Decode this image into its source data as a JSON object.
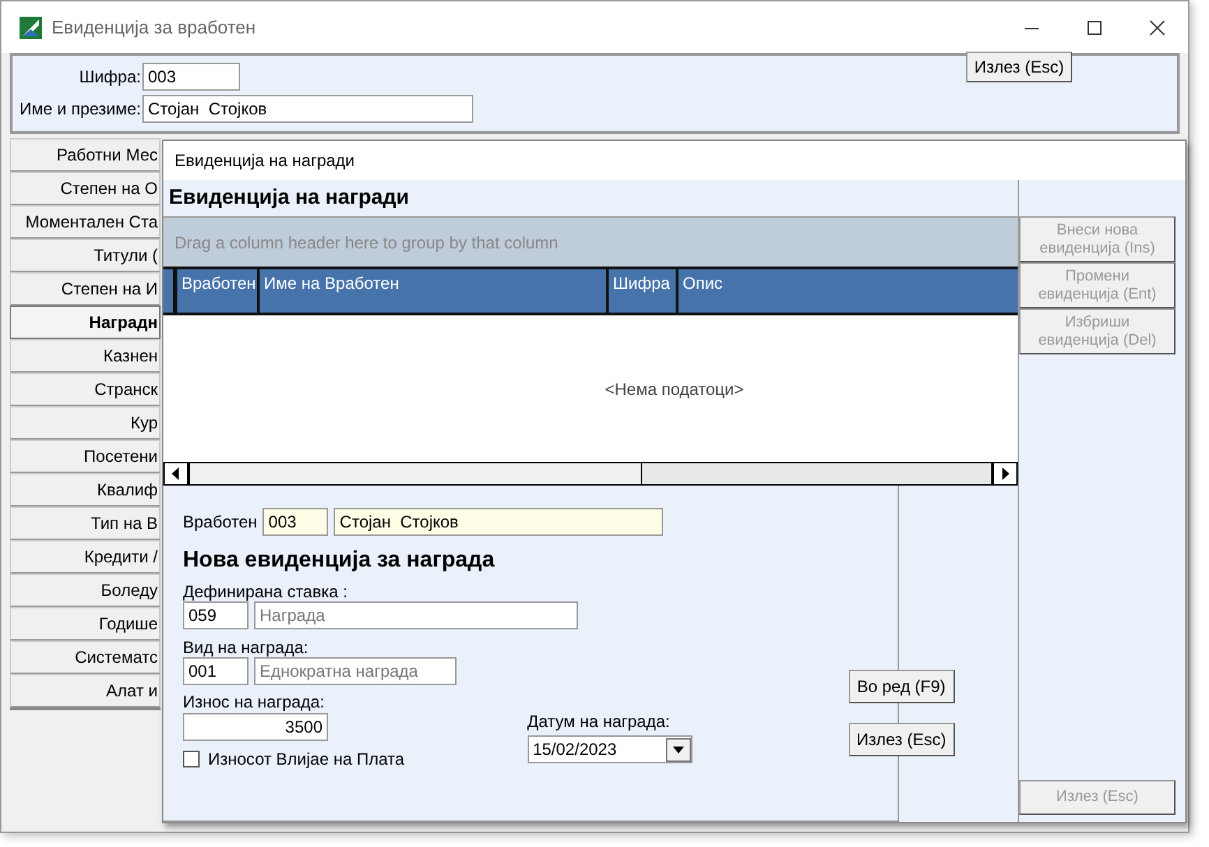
{
  "window": {
    "title": "Евиденција за вработен",
    "exit_button": "Излез (Esc)"
  },
  "employee": {
    "code_label": "Шифра:",
    "code": "003",
    "name_label": "Име и презиме:",
    "name": "Стојан  Стојков"
  },
  "sidebar": {
    "items": [
      {
        "label": "Работни Мес",
        "selected": false
      },
      {
        "label": "Степен на О",
        "selected": false
      },
      {
        "label": "Моментален Ста",
        "selected": false
      },
      {
        "label": "Титули (",
        "selected": false
      },
      {
        "label": "Степен на И",
        "selected": false
      },
      {
        "label": "Наградн",
        "selected": true
      },
      {
        "label": "Казнен",
        "selected": false
      },
      {
        "label": "Странск",
        "selected": false
      },
      {
        "label": "Кур",
        "selected": false
      },
      {
        "label": "Посетени",
        "selected": false
      },
      {
        "label": "Квалиф",
        "selected": false
      },
      {
        "label": "Тип на В",
        "selected": false
      },
      {
        "label": "Кредити /",
        "selected": false
      },
      {
        "label": "Боледу",
        "selected": false
      },
      {
        "label": "Годише",
        "selected": false
      },
      {
        "label": "Систематс",
        "selected": false
      },
      {
        "label": "Алат и",
        "selected": false
      }
    ]
  },
  "dialog": {
    "title": "Евиденција на награди",
    "heading": "Евиденција на награди",
    "grid": {
      "group_hint": "Drag a column header here to group by that column",
      "columns": [
        "Вработен",
        "Име на Вработен",
        "Шифра",
        "Опис"
      ],
      "empty_text": "<Нема податоци>"
    },
    "side_buttons": [
      {
        "label": "Внеси нова\nевиденција (Ins)",
        "disabled": true
      },
      {
        "label": "Промени\nевиденција (Ent)",
        "disabled": true
      },
      {
        "label": "Избриши\nевиденција (Del)",
        "disabled": true
      }
    ],
    "exit_button": {
      "label": "Излез (Esc)",
      "disabled": true
    },
    "form": {
      "employee_label": "Вработен",
      "employee_code": "003",
      "employee_name": "Стојан  Стојков",
      "heading": "Нова евиденција за награда",
      "item_label": "Дефинирана ставка :",
      "item_code": "059",
      "item_name": "Награда",
      "type_label": "Вид на награда:",
      "type_code": "001",
      "type_name": "Еднократна награда",
      "amount_label": "Износ на награда:",
      "amount": "3500",
      "affects_salary": {
        "label": "Износот Влијае на Плата",
        "checked": false
      },
      "date_label": "Датум на награда:",
      "date": "15/02/2023",
      "buttons": [
        "Во ред (F9)",
        "Излез (Esc)"
      ]
    }
  }
}
